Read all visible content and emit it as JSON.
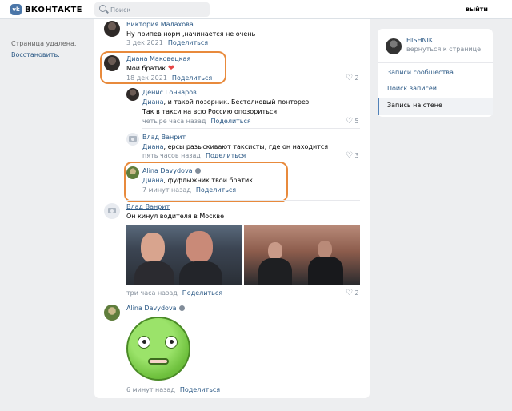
{
  "header": {
    "logo_mark": "vk",
    "logo_text": "ВКОНТАКТЕ",
    "search_placeholder": "Поиск",
    "logout": "выйти"
  },
  "left": {
    "deleted": "Страница удалена.",
    "restore": "Восстановить."
  },
  "comments": [
    {
      "name": "Виктория Малахова",
      "text": "Ну припев норм ,начинается не очень",
      "date": "3 дек 2021",
      "reply": "Поделиться"
    },
    {
      "name": "Диана Маковецкая",
      "text": "Мой братик",
      "date": "18 дек 2021",
      "reply": "Поделиться",
      "likes": "2"
    },
    {
      "name": "Денис Гончаров",
      "mention": "Диана",
      "text": ", и такой позорник. Бестолковый понторез.",
      "text2": "Так в такси на всю Россию опозориться",
      "date": "четыре часа назад",
      "reply": "Поделиться",
      "likes": "5"
    },
    {
      "name": "Влад Ванрит",
      "mention": "Диана",
      "text": ", ерсы разыскивают таксисты, где он находится",
      "date": "пять часов назад",
      "reply": "Поделиться",
      "likes": "3"
    },
    {
      "name": "Alina Davydova",
      "mention": "Диана",
      "text": ", фуфлыжник твой братик",
      "date": "7 минут назад",
      "reply": "Поделиться"
    },
    {
      "name": "Влад Ванрит",
      "text": "Он кинул водителя в Москве",
      "date": "три часа назад",
      "reply": "Поделиться",
      "likes": "2"
    },
    {
      "name": "Alina Davydova",
      "date": "6 минут назад",
      "reply": "Поделиться"
    }
  ],
  "right": {
    "user": "HISHNIK",
    "back": "вернуться к странице",
    "items": [
      "Записи сообщества",
      "Поиск записей",
      "Запись на стене"
    ]
  },
  "colors": {
    "accent": "#2a5885",
    "highlight": "#e88a3c",
    "brand": "#4a76a8"
  }
}
